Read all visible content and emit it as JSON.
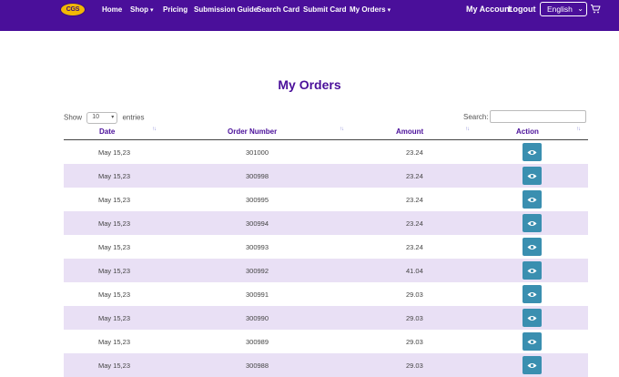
{
  "header": {
    "logo_text": "CGS",
    "nav": [
      {
        "label": "Home"
      },
      {
        "label": "Shop"
      },
      {
        "label": "Pricing"
      },
      {
        "label": "Submission Guide"
      },
      {
        "label": "Search Card"
      },
      {
        "label": "Submit Card"
      },
      {
        "label": "My Orders"
      }
    ],
    "my_account": "My Account",
    "logout": "Logout",
    "language": "English",
    "cart_icon": "cart-icon"
  },
  "page": {
    "title": "My Orders"
  },
  "controls": {
    "show_label": "Show",
    "entries_value": "10",
    "entries_label": "entries",
    "search_label": "Search:",
    "search_value": ""
  },
  "table": {
    "columns": [
      "Date",
      "Order Number",
      "Amount",
      "Action"
    ],
    "rows": [
      {
        "date": "May 15,23",
        "order": "301000",
        "amount": "23.24"
      },
      {
        "date": "May 15,23",
        "order": "300998",
        "amount": "23.24"
      },
      {
        "date": "May 15,23",
        "order": "300995",
        "amount": "23.24"
      },
      {
        "date": "May 15,23",
        "order": "300994",
        "amount": "23.24"
      },
      {
        "date": "May 15,23",
        "order": "300993",
        "amount": "23.24"
      },
      {
        "date": "May 15,23",
        "order": "300992",
        "amount": "41.04"
      },
      {
        "date": "May 15,23",
        "order": "300991",
        "amount": "29.03"
      },
      {
        "date": "May 15,23",
        "order": "300990",
        "amount": "29.03"
      },
      {
        "date": "May 15,23",
        "order": "300989",
        "amount": "29.03"
      },
      {
        "date": "May 15,23",
        "order": "300988",
        "amount": "29.03"
      }
    ]
  },
  "colors": {
    "brand_purple": "#4a0f9a",
    "row_alt": "#e9e0f5",
    "view_button": "#3a8fb0",
    "logo_gold": "#f2b705"
  }
}
